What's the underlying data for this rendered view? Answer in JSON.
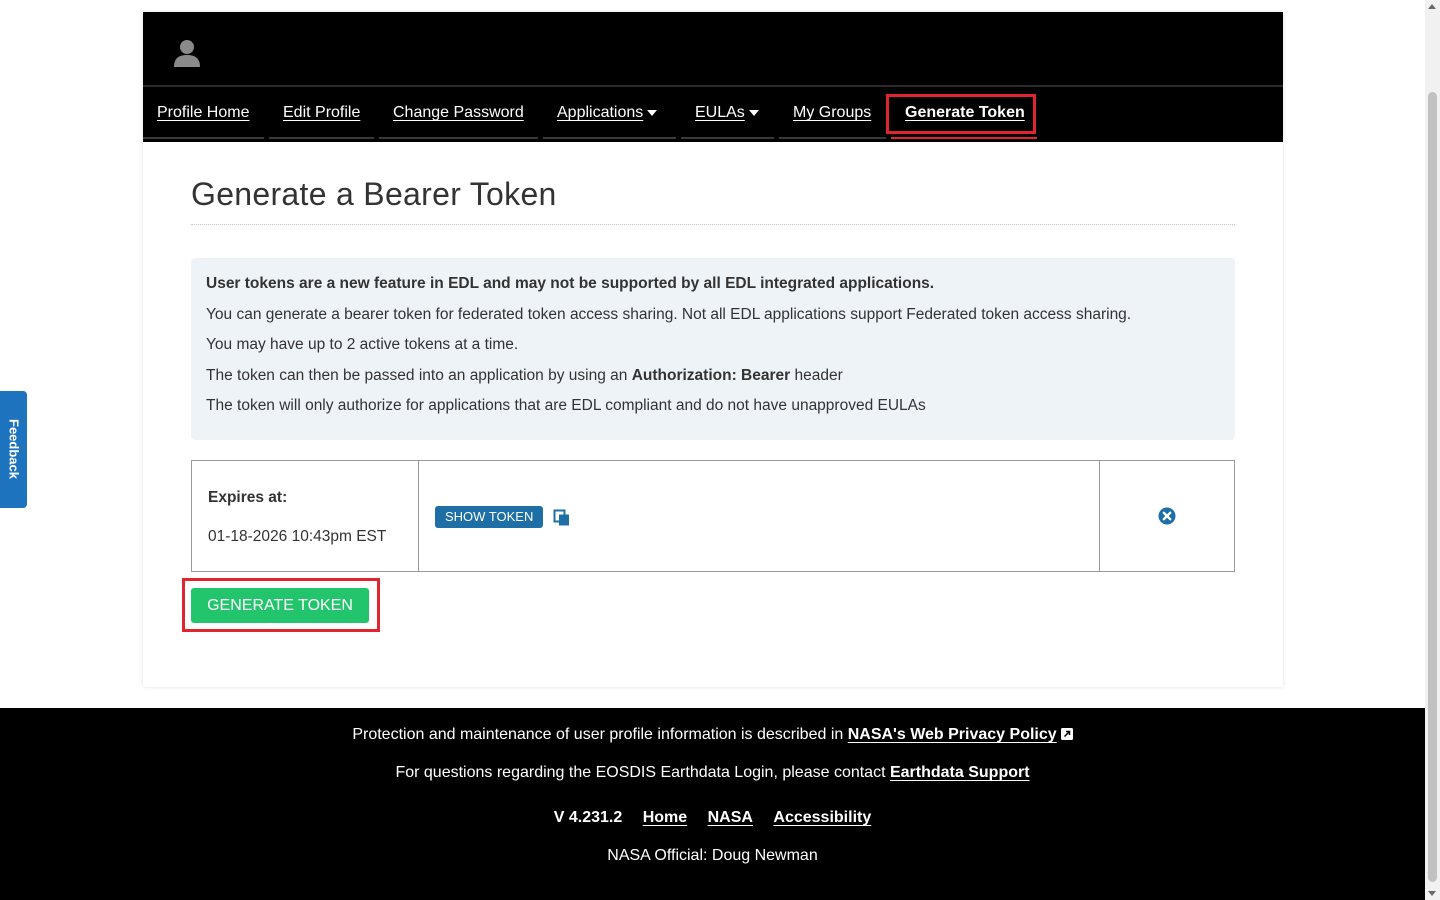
{
  "nav": {
    "items": [
      {
        "label": "Profile Home"
      },
      {
        "label": "Edit Profile"
      },
      {
        "label": "Change Password"
      },
      {
        "label": "Applications"
      },
      {
        "label": "EULAs"
      },
      {
        "label": "My Groups"
      },
      {
        "label": "Generate Token"
      }
    ],
    "active": "Generate Token",
    "avatar_icon": "user-icon"
  },
  "main": {
    "title": "Generate a Bearer Token",
    "info": {
      "line1": "User tokens are a new feature in EDL and may not be supported by all EDL integrated applications.",
      "line2": "You can generate a bearer token for federated token access sharing. Not all EDL applications support Federated token access sharing.",
      "line3": "You may have up to 2 active tokens at a time.",
      "line4_prefix": "The token can then be passed into an application by using an",
      "line4_bold": "Authorization: Bearer",
      "line4_suffix": "header",
      "line5": "The token will only authorize for applications that are EDL compliant and do not have unapproved EULAs"
    },
    "tokens": [
      {
        "expires_label": "Expires at:",
        "expires_value": "01-18-2026 10:43pm EST",
        "show_label": "SHOW TOKEN",
        "copy_icon": "copy-icon",
        "revoke_icon": "remove-circle-icon"
      }
    ],
    "generate_label": "GENERATE TOKEN"
  },
  "footer": {
    "privacy_prefix": "Protection and maintenance of user profile information is described in",
    "privacy_link": "NASA's Web Privacy Policy",
    "support_prefix": "For questions regarding the EOSDIS Earthdata Login, please contact",
    "support_link": "Earthdata Support",
    "version": "V 4.231.2",
    "links": [
      {
        "label": "Home"
      },
      {
        "label": "NASA"
      },
      {
        "label": "Accessibility"
      }
    ],
    "official": "NASA Official: Doug Newman"
  },
  "feedback": {
    "label": "Feedback"
  },
  "colors": {
    "nav_bg": "#000000",
    "highlight": "#e02530",
    "primary_button": "#22c56c",
    "show_token_button": "#1e6fa5",
    "info_bg": "#eef3f7",
    "feedback_tab": "#1e73be"
  }
}
